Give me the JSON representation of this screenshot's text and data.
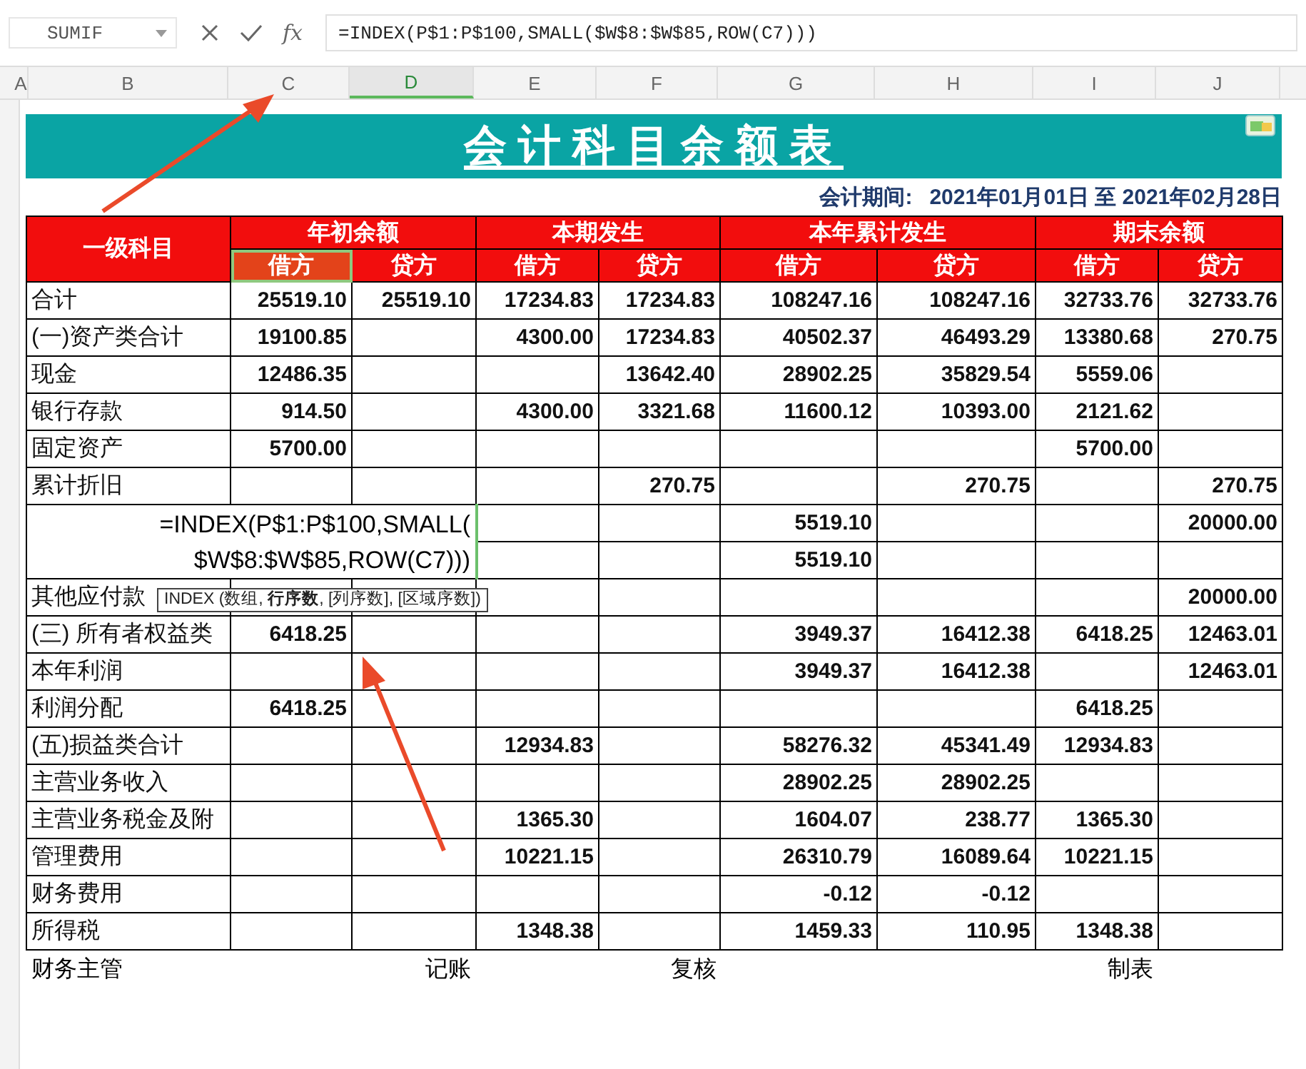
{
  "formula_bar": {
    "name_box": "SUMIF",
    "fx": "fx",
    "formula": "=INDEX(P$1:P$100,SMALL($W$8:$W$85,ROW(C7)))"
  },
  "column_headers": [
    {
      "label": "A",
      "selected": false
    },
    {
      "label": "B",
      "selected": false
    },
    {
      "label": "C",
      "selected": false
    },
    {
      "label": "D",
      "selected": true
    },
    {
      "label": "E",
      "selected": false
    },
    {
      "label": "F",
      "selected": false
    },
    {
      "label": "G",
      "selected": false
    },
    {
      "label": "H",
      "selected": false
    },
    {
      "label": "I",
      "selected": false
    },
    {
      "label": "J",
      "selected": false
    }
  ],
  "title": "会计科目余额表",
  "period": {
    "label": "会计期间:",
    "value": "2021年01月01日 至 2021年02月28日"
  },
  "header": {
    "subject": "一级科目",
    "groups": [
      "年初余额",
      "本期发生",
      "本年累计发生",
      "期末余额"
    ],
    "sub": [
      {
        "label": "借方",
        "selected": true
      },
      {
        "label": "贷方",
        "selected": false
      },
      {
        "label": "借方",
        "selected": false
      },
      {
        "label": "贷方",
        "selected": false
      },
      {
        "label": "借方",
        "selected": false
      },
      {
        "label": "贷方",
        "selected": false
      },
      {
        "label": "借方",
        "selected": false
      },
      {
        "label": "贷方",
        "selected": false
      }
    ]
  },
  "rows": [
    {
      "label": "合计",
      "cells": [
        "25519.10",
        "25519.10",
        "17234.83",
        "17234.83",
        "108247.16",
        "108247.16",
        "32733.76",
        "32733.76"
      ]
    },
    {
      "label": "(一)资产类合计",
      "cells": [
        "19100.85",
        null,
        "4300.00",
        "17234.83",
        "40502.37",
        "46493.29",
        "13380.68",
        "270.75"
      ]
    },
    {
      "label": "现金",
      "cells": [
        "12486.35",
        null,
        null,
        "13642.40",
        "28902.25",
        "35829.54",
        "5559.06",
        null
      ]
    },
    {
      "label": "银行存款",
      "cells": [
        "914.50",
        null,
        "4300.00",
        "3321.68",
        "11600.12",
        "10393.00",
        "2121.62",
        null
      ]
    },
    {
      "label": "固定资产",
      "cells": [
        "5700.00",
        null,
        null,
        null,
        null,
        null,
        "5700.00",
        null
      ]
    },
    {
      "label": "累计折旧",
      "cells": [
        null,
        null,
        null,
        "270.75",
        null,
        "270.75",
        null,
        "270.75"
      ]
    },
    {
      "kind": "editing",
      "cells": [
        null,
        null,
        null,
        null,
        "5519.10",
        null,
        null,
        "20000.00"
      ]
    },
    {
      "kind": "covered",
      "cells": [
        null,
        null,
        null,
        null,
        "5519.10",
        null,
        null,
        null
      ]
    },
    {
      "label": "其他应付款",
      "cells": [
        null,
        null,
        null,
        null,
        null,
        null,
        null,
        "20000.00"
      ]
    },
    {
      "label": "(三) 所有者权益类",
      "cells": [
        "6418.25",
        null,
        null,
        null,
        "3949.37",
        "16412.38",
        "6418.25",
        "12463.01"
      ]
    },
    {
      "label": "本年利润",
      "cells": [
        null,
        null,
        null,
        null,
        "3949.37",
        "16412.38",
        null,
        "12463.01"
      ]
    },
    {
      "label": "利润分配",
      "cells": [
        "6418.25",
        null,
        null,
        null,
        null,
        null,
        "6418.25",
        null
      ]
    },
    {
      "label": "(五)损益类合计",
      "cells": [
        null,
        null,
        "12934.83",
        null,
        "58276.32",
        "45341.49",
        "12934.83",
        null
      ]
    },
    {
      "label": "主营业务收入",
      "cells": [
        null,
        null,
        null,
        null,
        "28902.25",
        "28902.25",
        null,
        null
      ]
    },
    {
      "label": "主营业务税金及附",
      "cells": [
        null,
        null,
        "1365.30",
        null,
        "1604.07",
        "238.77",
        "1365.30",
        null
      ]
    },
    {
      "label": "管理费用",
      "cells": [
        null,
        null,
        "10221.15",
        null,
        "26310.79",
        "16089.64",
        "10221.15",
        null
      ]
    },
    {
      "label": "财务费用",
      "cells": [
        null,
        null,
        null,
        null,
        "-0.12",
        "-0.12",
        null,
        null
      ]
    },
    {
      "label": "所得税",
      "cells": [
        null,
        null,
        "1348.38",
        null,
        "1459.33",
        "110.95",
        "1348.38",
        null
      ]
    }
  ],
  "cell_editor": {
    "lines": [
      "=INDEX(P$1:P$100,SMALL(",
      "$W$8:$W$85,ROW(C7)))"
    ]
  },
  "tooltip": "INDEX (数组, **行序数**, [列序数], [区域序数])",
  "footer": [
    "财务主管",
    "记账",
    "复核",
    "制表"
  ]
}
